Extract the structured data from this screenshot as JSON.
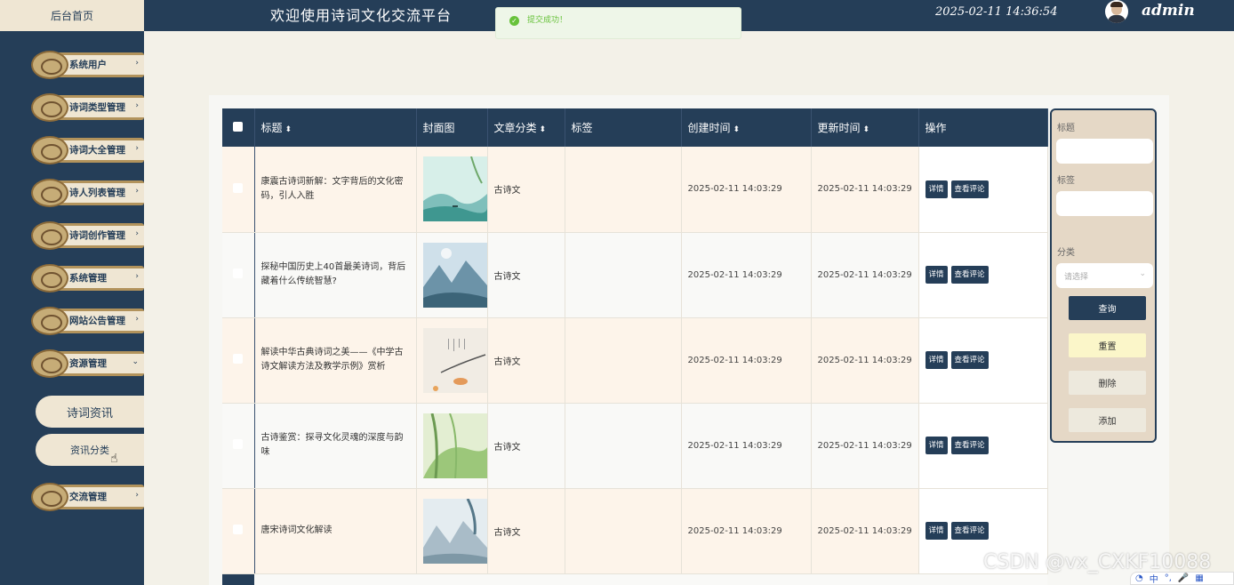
{
  "header": {
    "home_label": "后台首页",
    "site_title": "欢迎使用诗词文化交流平台",
    "datetime": "2025-02-11 14:36:54",
    "username": "admin"
  },
  "toast": {
    "icon": "check-icon",
    "text": "提交成功！"
  },
  "sidebar": {
    "items": [
      {
        "label": "系统用户"
      },
      {
        "label": "诗词类型管理"
      },
      {
        "label": "诗词大全管理"
      },
      {
        "label": "诗人列表管理"
      },
      {
        "label": "诗词创作管理"
      },
      {
        "label": "系统管理"
      },
      {
        "label": "网站公告管理"
      },
      {
        "label": "资源管理"
      }
    ],
    "sub_items": [
      {
        "label": "诗词资讯"
      },
      {
        "label": "资讯分类"
      }
    ],
    "last_item": {
      "label": "交流管理"
    }
  },
  "table": {
    "headers": {
      "title": "标题",
      "cover": "封面图",
      "category": "文章分类",
      "tags": "标签",
      "created": "创建时间",
      "updated": "更新时间",
      "actions": "操作"
    },
    "detail_label": "详情",
    "comments_label": "查看评论",
    "rows": [
      {
        "title": "康震古诗词新解：文字背后的文化密码，引人入胜",
        "category": "古诗文",
        "tags": "",
        "created": "2025-02-11 14:03:29",
        "updated": "2025-02-11 14:03:29"
      },
      {
        "title": "探秘中国历史上40首最美诗词，背后藏着什么传统智慧?",
        "category": "古诗文",
        "tags": "",
        "created": "2025-02-11 14:03:29",
        "updated": "2025-02-11 14:03:29"
      },
      {
        "title": "解读中华古典诗词之美——《中学古诗文解读方法及教学示例》赏析",
        "category": "古诗文",
        "tags": "",
        "created": "2025-02-11 14:03:29",
        "updated": "2025-02-11 14:03:29"
      },
      {
        "title": "古诗鉴赏：探寻文化灵魂的深度与韵味",
        "category": "古诗文",
        "tags": "",
        "created": "2025-02-11 14:03:29",
        "updated": "2025-02-11 14:03:29"
      },
      {
        "title": "唐宋诗词文化解读",
        "category": "古诗文",
        "tags": "",
        "created": "2025-02-11 14:03:29",
        "updated": "2025-02-11 14:03:29"
      }
    ]
  },
  "search": {
    "title_label": "标题",
    "tag_label": "标签",
    "category_label": "分类",
    "select_placeholder": "请选择",
    "query_button": "查询",
    "reset_button": "重置",
    "delete_button": "删除",
    "add_button": "添加"
  },
  "colors": {
    "primary": "#253e58",
    "cream": "#efe6d3",
    "gold": "#b2935c",
    "success": "#67c23a"
  },
  "watermark": "CSDN @vx_CXKF10088",
  "ime": {
    "label": "中"
  }
}
